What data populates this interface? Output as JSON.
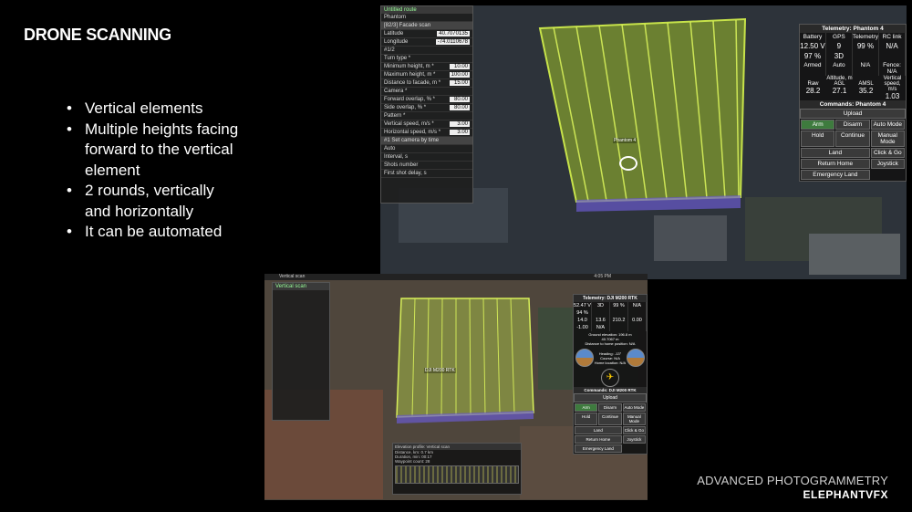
{
  "slide": {
    "title": "DRONE SCANNING",
    "bullet_main": "Vertical elements",
    "sub_bullets": [
      "Multiple heights facing forward to the vertical element",
      "2 rounds, vertically and horizontally",
      "It can be automated"
    ],
    "footer_line1": "ADVANCED PHOTOGRAMMETRY",
    "footer_line2": "ELEPHANTVFX"
  },
  "screenshot1": {
    "mission_name": "[82/3] Facade scan",
    "top_label": "Untitled route",
    "vehicle_tab": "Phantom",
    "latitude_label": "Latitude",
    "latitude": "40.7070135",
    "longitude_label": "Longitude",
    "longitude": "-74.0110678",
    "waypoint": "#1/2",
    "params": [
      {
        "label": "Turn type *",
        "value": ""
      },
      {
        "label": "Minimum height, m *",
        "value": "10.00"
      },
      {
        "label": "Maximum height, m *",
        "value": "100.00"
      },
      {
        "label": "Distance to facade, m *",
        "value": "15.00"
      },
      {
        "label": "Camera *",
        "value": ""
      },
      {
        "label": "Forward overlap, % *",
        "value": "80.00"
      },
      {
        "label": "Side overlap, % *",
        "value": "80.00"
      },
      {
        "label": "Pattern *",
        "value": ""
      },
      {
        "label": "Vertical speed, m/s *",
        "value": "3.00"
      },
      {
        "label": "Horizontal speed, m/s *",
        "value": "3.00"
      }
    ],
    "camera_action": "#1 Set camera by time",
    "camera_rows": [
      "Auto",
      "Interval, s",
      "Shots number",
      "First shot delay, s"
    ],
    "drone_label": "Phantom 4",
    "telemetry_title": "Telemetry: Phantom 4",
    "tele_headers": [
      "Battery",
      "GPS",
      "Telemetry",
      "RC link"
    ],
    "battery_v": "12.50 V",
    "battery_pct": "97 %",
    "gps_sats": "9",
    "gps_fix": "3D",
    "telemetry_pct": "99 %",
    "rc_link": "N/A",
    "armed_row": [
      "Armed",
      "Auto",
      "N/A",
      "Fence: N/A"
    ],
    "altitude_label": "Altitude, m",
    "alt_headers": [
      "Raw",
      "AGL",
      "AMSL"
    ],
    "alt_values": [
      "28.2",
      "27.1",
      "35.2"
    ],
    "vspeed_label": "Vertical speed, m/s",
    "vspeed_value": "1.03",
    "commands_title": "Commands: Phantom 4",
    "upload": "Upload",
    "buttons": [
      "Arm",
      "Disarm",
      "Auto Mode",
      "Hold",
      "Continue",
      "Manual Mode",
      "Land",
      "Click & Go",
      "Return Home",
      "Joystick",
      "Emergency Land"
    ]
  },
  "screenshot2": {
    "title": "Vertical scan",
    "time": "4:05 PM",
    "telemetry_title": "Telemetry: DJI M200 RTK",
    "battery_v": "52.47 V",
    "battery_pct": "94 %",
    "gps_fix": "3D",
    "telemetry_pct": "99 %",
    "rc_link": "N/A",
    "alt_values": [
      "14.0",
      "13.6",
      "210.2"
    ],
    "vspeed_value": "0.00",
    "ground_speed": "-1.00",
    "hspeed": "N/A",
    "info_lines": [
      "Ground elevation: 196.8 m",
      "40.7067 m",
      "Distance to home position: N/A"
    ],
    "heading_lines": [
      "Heading: -13°",
      "Course: N/A",
      "Home location: N/A"
    ],
    "commands_title": "Commands: DJI M200 RTK",
    "upload": "Upload",
    "buttons": [
      "Arm",
      "Disarm",
      "Auto Mode",
      "Hold",
      "Continue",
      "Manual Mode",
      "Land",
      "Click & Go",
      "Return Home",
      "Joystick",
      "Emergency Land"
    ],
    "drone_label": "DJI M200 RTK",
    "bottom_title": "Elevation profile: Vertical scan",
    "bottom_rows": [
      "Distance, km: 0.7 km",
      "Duration, min: 00:17",
      "Waypoint count: 28"
    ],
    "sidebar_title": "Vertical scan"
  }
}
